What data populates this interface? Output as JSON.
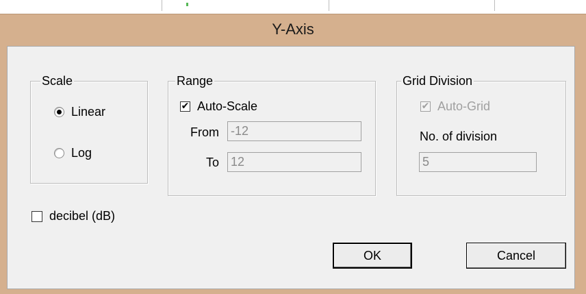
{
  "dialog": {
    "title": "Y-Axis"
  },
  "scale": {
    "legend": "Scale",
    "options": [
      {
        "label": "Linear",
        "selected": true
      },
      {
        "label": "Log",
        "selected": false
      }
    ]
  },
  "range": {
    "legend": "Range",
    "auto_scale_label": "Auto-Scale",
    "auto_scale_checked": true,
    "from_label": "From",
    "from_value": "-12",
    "to_label": "To",
    "to_value": "12"
  },
  "grid": {
    "legend": "Grid Division",
    "auto_grid_label": "Auto-Grid",
    "auto_grid_checked": true,
    "divisions_label": "No. of division",
    "divisions_value": "5"
  },
  "decibel": {
    "label": "decibel (dB)",
    "checked": false
  },
  "buttons": {
    "ok_label": "OK",
    "cancel_label": "Cancel"
  },
  "colors": {
    "title_bar": "#d5b08e",
    "client_bg": "#f0f0f0",
    "disabled_text": "#a0a0a0"
  },
  "icons": {
    "check_mark": "✔"
  }
}
